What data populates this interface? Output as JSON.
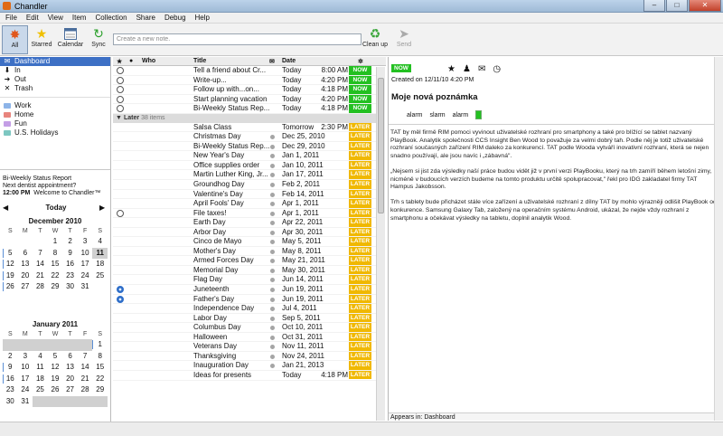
{
  "app": {
    "title": "Chandler"
  },
  "menu": [
    "File",
    "Edit",
    "View",
    "Item",
    "Collection",
    "Share",
    "Debug",
    "Help"
  ],
  "toolbar": {
    "all": "All",
    "starred": "Starred",
    "calendar": "Calendar",
    "sync": "Sync",
    "cleanup": "Clean up",
    "send": "Send",
    "newnote_placeholder": "Create a new note."
  },
  "sidebar": {
    "items": [
      {
        "label": "Dashboard",
        "icon": "dashboard-icon"
      },
      {
        "label": "In",
        "icon": "in-icon"
      },
      {
        "label": "Out",
        "icon": "out-icon"
      },
      {
        "label": "Trash",
        "icon": "trash-icon"
      }
    ],
    "collections": [
      {
        "label": "Work",
        "color": "#8db4e8"
      },
      {
        "label": "Home",
        "color": "#e8857d"
      },
      {
        "label": "Fun",
        "color": "#c49ee6"
      },
      {
        "label": "U.S. Holidays",
        "color": "#7dc7c1"
      }
    ]
  },
  "preview": {
    "line1": "Bi-Weekly Status Report",
    "line2": "Next dentist appointment?",
    "time": "12:00 PM",
    "line3": "Welcome to Chandler™"
  },
  "calendar": {
    "today_label": "Today",
    "dow": [
      "S",
      "M",
      "T",
      "W",
      "T",
      "F",
      "S"
    ],
    "dec": {
      "title": "December 2010",
      "days": [
        "",
        "",
        "",
        "1",
        "2",
        "3",
        "4",
        "5",
        "6",
        "7",
        "8",
        "9",
        "10",
        "11",
        "12",
        "13",
        "14",
        "15",
        "16",
        "17",
        "18",
        "19",
        "20",
        "21",
        "22",
        "23",
        "24",
        "25",
        "26",
        "27",
        "28",
        "29",
        "30",
        "31",
        ""
      ]
    },
    "jan": {
      "title": "January 2011",
      "days": [
        "",
        "",
        "",
        "",
        "",
        "",
        "1",
        "2",
        "3",
        "4",
        "5",
        "6",
        "7",
        "8",
        "9",
        "10",
        "11",
        "12",
        "13",
        "14",
        "15",
        "16",
        "17",
        "18",
        "19",
        "20",
        "21",
        "22",
        "23",
        "24",
        "25",
        "26",
        "27",
        "28",
        "29",
        "30",
        "31",
        "",
        "",
        "",
        "",
        ""
      ]
    }
  },
  "list": {
    "headers": {
      "who": "Who",
      "title": "Title",
      "date": "Date"
    },
    "now_rows": [
      {
        "title": "Tell a friend about Cr...",
        "date": "Today",
        "time": "8:00 AM",
        "status": "NOW"
      },
      {
        "title": "Write-up...",
        "date": "Today",
        "time": "4:20 PM",
        "status": "NOW"
      },
      {
        "title": "Follow up with...on...",
        "date": "Today",
        "time": "4:18 PM",
        "status": "NOW"
      },
      {
        "title": "Start planning vacation",
        "date": "Today",
        "time": "4:20 PM",
        "status": "NOW"
      },
      {
        "title": "Bi-Weekly Status Rep...",
        "date": "Today",
        "time": "4:18 PM",
        "status": "NOW"
      }
    ],
    "later_group": {
      "label": "Later",
      "count": "38 items"
    },
    "later_rows": [
      {
        "title": "Salsa Class",
        "date": "Tomorrow",
        "time": "2:30 PM",
        "status": "LATER"
      },
      {
        "title": "Christmas Day",
        "date": "Dec 25, 2010",
        "time": "",
        "status": "LATER"
      },
      {
        "title": "Bi-Weekly Status Rep...",
        "date": "Dec 29, 2010",
        "time": "",
        "status": "LATER"
      },
      {
        "title": "New Year's Day",
        "date": "Jan 1, 2011",
        "time": "",
        "status": "LATER"
      },
      {
        "title": "Office supplies order",
        "date": "Jan 10, 2011",
        "time": "",
        "status": "LATER"
      },
      {
        "title": "Martin Luther King, Jr...",
        "date": "Jan 17, 2011",
        "time": "",
        "status": "LATER"
      },
      {
        "title": "Groundhog Day",
        "date": "Feb 2, 2011",
        "time": "",
        "status": "LATER"
      },
      {
        "title": "Valentine's Day",
        "date": "Feb 14, 2011",
        "time": "",
        "status": "LATER"
      },
      {
        "title": "April Fools' Day",
        "date": "Apr 1, 2011",
        "time": "",
        "status": "LATER"
      },
      {
        "title": "File taxes!",
        "date": "Apr 1, 2011",
        "time": "",
        "status": "LATER"
      },
      {
        "title": "Earth Day",
        "date": "Apr 22, 2011",
        "time": "",
        "status": "LATER"
      },
      {
        "title": "Arbor Day",
        "date": "Apr 30, 2011",
        "time": "",
        "status": "LATER"
      },
      {
        "title": "Cinco de Mayo",
        "date": "May 5, 2011",
        "time": "",
        "status": "LATER"
      },
      {
        "title": "Mother's Day",
        "date": "May 8, 2011",
        "time": "",
        "status": "LATER"
      },
      {
        "title": "Armed Forces Day",
        "date": "May 21, 2011",
        "time": "",
        "status": "LATER"
      },
      {
        "title": "Memorial Day",
        "date": "May 30, 2011",
        "time": "",
        "status": "LATER"
      },
      {
        "title": "Flag Day",
        "date": "Jun 14, 2011",
        "time": "",
        "status": "LATER"
      },
      {
        "title": "Juneteenth",
        "date": "Jun 19, 2011",
        "time": "",
        "status": "LATER"
      },
      {
        "title": "Father's Day",
        "date": "Jun 19, 2011",
        "time": "",
        "status": "LATER"
      },
      {
        "title": "Independence Day",
        "date": "Jul 4, 2011",
        "time": "",
        "status": "LATER"
      },
      {
        "title": "Labor Day",
        "date": "Sep 5, 2011",
        "time": "",
        "status": "LATER"
      },
      {
        "title": "Columbus Day",
        "date": "Oct 10, 2011",
        "time": "",
        "status": "LATER"
      },
      {
        "title": "Halloween",
        "date": "Oct 31, 2011",
        "time": "",
        "status": "LATER"
      },
      {
        "title": "Veterans Day",
        "date": "Nov 11, 2011",
        "time": "",
        "status": "LATER"
      },
      {
        "title": "Thanksgiving",
        "date": "Nov 24, 2011",
        "time": "",
        "status": "LATER"
      },
      {
        "title": "Inauguration Day",
        "date": "Jan 21, 2013",
        "time": "",
        "status": "LATER"
      },
      {
        "title": "Ideas for presents",
        "date": "Today",
        "time": "4:18 PM",
        "status": "LATER"
      }
    ]
  },
  "detail": {
    "status": "NOW",
    "created": "Created on 12/11/10 4:20 PM",
    "title": "Moje nová poznámka",
    "alarms": [
      "alarm",
      "slarm",
      "alarm"
    ],
    "body": [
      "TAT by měl firmě RIM pomoci vyvinout uživatelské rozhraní pro smartphony a také pro blížící se tablet nazvaný PlayBook. Analytik společnosti CCS Insight Ben Wood to považuje za velmi dobrý tah. Podle něj je totiž uživatelské rozhraní současných zařízení RIM daleko za konkurencí. TAT podle Wooda vytváří inovativní rozhraní, která se nejen snadno používají, ale jsou navíc i „zábavná\".",
      "„Nejsem si jist zda výsledky naší práce budou vidět již v první verzi PlayBooku, který na trh zamíří během letošní zimy, nicméně v budoucích verzích budeme na tomto produktu určitě spolupracovat,\" řekl pro IDG zakladatel firmy TAT Hampus Jakobsson.",
      "Trh s tablety bude přicházet stále více zařízení a uživatelské rozhraní z dílny TAT by mohlo výrazněji odlišit PlayBook od konkurence. Samsung Galaxy Tab, založený na operačním systému Android, ukázal, že nejde vždy rozhraní z smartphonu a očekávat výsledky na tabletu, doplnil analytik Wood."
    ],
    "appears_in": "Appears in: Dashboard"
  },
  "colors": {
    "now": "#23c021",
    "later": "#f0b800",
    "selection": "#3d70c5"
  }
}
